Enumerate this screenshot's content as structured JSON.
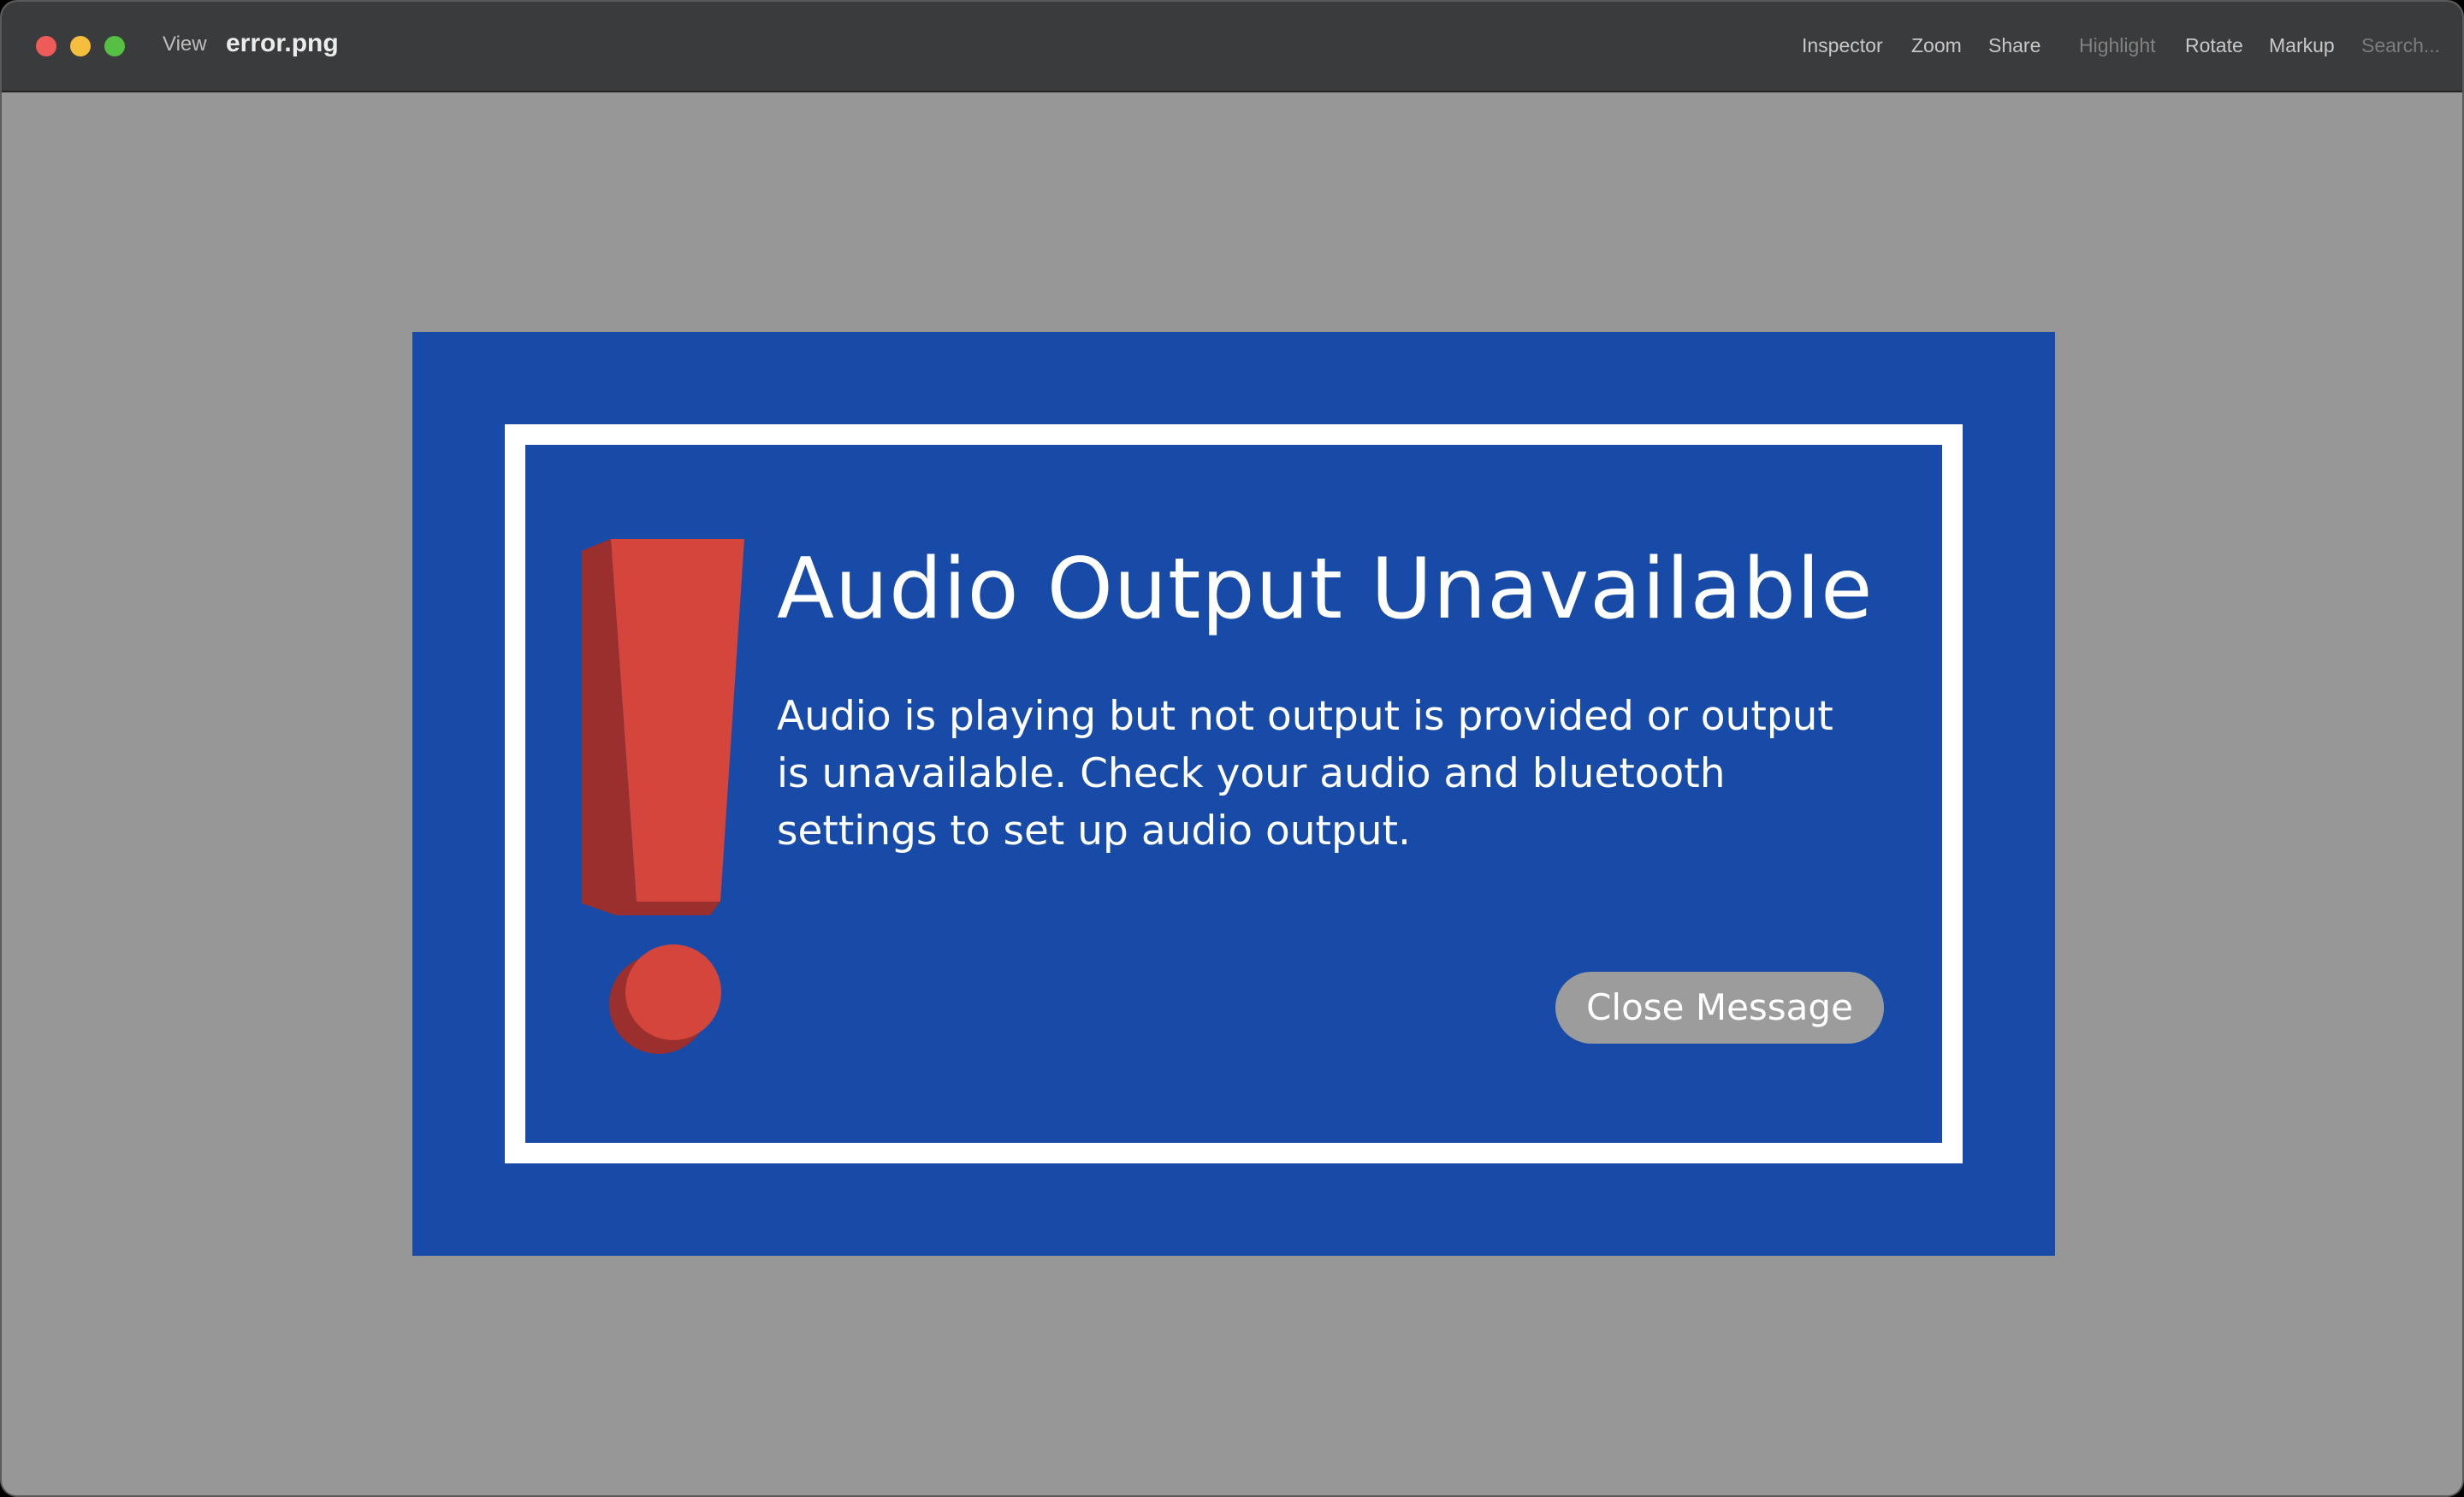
{
  "window": {
    "title": "error.png",
    "menu_view": "View"
  },
  "toolbar": {
    "inspector": "Inspector",
    "zoom": "Zoom",
    "share": "Share",
    "highlight": "Highlight",
    "rotate": "Rotate",
    "markup": "Markup",
    "search_placeholder": "Search..."
  },
  "dialog": {
    "title": "Audio Output Unavailable",
    "body": "Audio is playing but not output is provided or output is unavailable. Check your audio and bluetooth settings to set up audio output.",
    "close_label": "Close Message",
    "icon": "exclamation-icon"
  },
  "colors": {
    "titlebar_bg": "#3a3b3d",
    "canvas_bg": "#979797",
    "dialog_blue": "#174ba7",
    "dialog_border": "#ffffff",
    "icon_red": "#d4453c",
    "icon_red_shadow": "#9a2f2d",
    "button_gray": "#9c9c9c"
  }
}
